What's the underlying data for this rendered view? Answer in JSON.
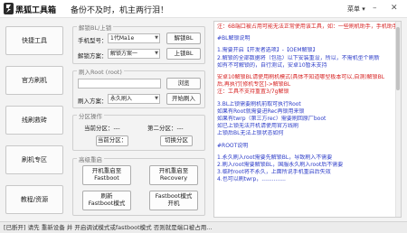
{
  "app": {
    "title": "黑狐工具箱",
    "slogan": "备份不及时，机主两行泪！",
    "menu_label": "菜单",
    "menu_icon": "▾",
    "minimize_icon": "–",
    "close_icon": "✕"
  },
  "sidebar": {
    "items": [
      {
        "label": "快捷工具"
      },
      {
        "label": "官方刷机"
      },
      {
        "label": "线刷救砖"
      },
      {
        "label": "刷机专区"
      },
      {
        "label": "教程/资源"
      }
    ]
  },
  "unlock": {
    "group_title": "解锁BL/上锁",
    "phone_label": "手机型号：",
    "phone_value": "1代Ma1e",
    "unlock_button": "解锁BL",
    "method_label": "解锁方案：",
    "method_value": "解锁方案一",
    "lock_button": "上锁BL"
  },
  "root": {
    "group_title": "刷入Root (root)",
    "file_value": "",
    "browse_button": "浏览",
    "flash_label": "刷入方案：",
    "flash_value": "永久刷入",
    "start_button": "开始刷入"
  },
  "partition": {
    "group_title": "分区操作",
    "current_label": "当前分区：",
    "current_value": "---",
    "second_label": "第二分区：",
    "second_value": "---",
    "switch_label": "切换分区"
  },
  "advanced": {
    "group_title": "高级重启",
    "buttons": [
      {
        "label": "开机重启至\nFastboot"
      },
      {
        "label": "开机重启至\nRecovery"
      },
      {
        "label": "刷新\nFastboot模式"
      },
      {
        "label": "Fastboot模式\n开机"
      }
    ]
  },
  "help": {
    "lines": [
      {
        "text": "注：6B端口被占用可能无法正常使用该工具，如：一些刷机助手，手机助手之类",
        "color": "red"
      },
      {
        "text": "",
        "color": "gap"
      },
      {
        "text": "#BL解锁说明",
        "color": "blue"
      },
      {
        "text": "",
        "color": "gap"
      },
      {
        "text": "1.需要开启【开发者选项】-【OEM解锁】",
        "color": "blue"
      },
      {
        "text": "2.解锁的全部数据将（包括）以下安装重设，所以，不需机型个刷新",
        "color": "blue"
      },
      {
        "text": "  如有不可解锁的，自行测试，安卓10暂未支持",
        "color": "blue"
      },
      {
        "text": "",
        "color": "gap"
      },
      {
        "text": "安卓10解锁BL请使用刷机模式(具体不知道哪型板本可以,自测)解锁BL",
        "color": "red"
      },
      {
        "text": "后,再执行[修机专区]->解锁BL",
        "color": "red"
      },
      {
        "text": "  注：工具不支持重置3/7g解锁",
        "color": "red"
      },
      {
        "text": "",
        "color": "gap"
      },
      {
        "text": "3.BL上锁需要刷机前取可执行Root",
        "color": "blue"
      },
      {
        "text": "  如果有Root就需要进Rec再锁用来锁",
        "color": "blue"
      },
      {
        "text": "  如果有twrp（第三方rec）需要刷回原厂boot",
        "color": "blue"
      },
      {
        "text": "  如已上锁无法开机请使用官方线刷",
        "color": "blue"
      },
      {
        "text": "  上锁后BL无法上锁状态如何",
        "color": "blue"
      },
      {
        "text": "",
        "color": "gap"
      },
      {
        "text": "#ROOT说明",
        "color": "blue"
      },
      {
        "text": "",
        "color": "gap"
      },
      {
        "text": "1.永久刷入root需要先解锁BL，导致刷入不需要",
        "color": "blue"
      },
      {
        "text": "2.刷入root需要解锁BL，国服永久刷入root后不需要",
        "color": "blue"
      },
      {
        "text": "3.临时root将不永久，上面所说手机重启后失效",
        "color": "blue"
      },
      {
        "text": "4.也可以刷twrp，..............",
        "color": "blue"
      }
    ]
  },
  "status": {
    "text": "[已断开] 请先 重新设备 并 开启调试模式或fastboot模式 否则就是端口被占用..."
  }
}
